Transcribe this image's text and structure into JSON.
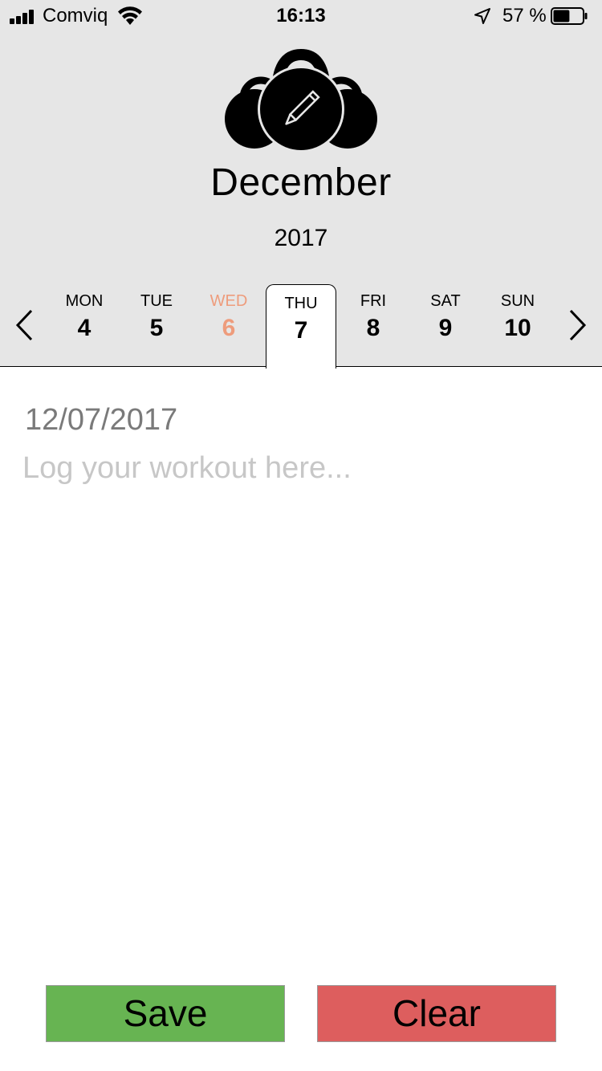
{
  "status_bar": {
    "carrier": "Comviq",
    "time": "16:13",
    "battery_percent": "57 %",
    "battery_level": 0.57
  },
  "header": {
    "logo_icon": "kettlebell-pencil-icon",
    "month": "December",
    "year": "2017"
  },
  "week": {
    "days": [
      {
        "name": "MON",
        "number": "4"
      },
      {
        "name": "TUE",
        "number": "5"
      },
      {
        "name": "WED",
        "number": "6"
      },
      {
        "name": "THU",
        "number": "7"
      },
      {
        "name": "FRI",
        "number": "8"
      },
      {
        "name": "SAT",
        "number": "9"
      },
      {
        "name": "SUN",
        "number": "10"
      }
    ],
    "today": "WED",
    "selected": "THU"
  },
  "entry": {
    "date": "12/07/2017",
    "value": "",
    "placeholder": "Log your workout here..."
  },
  "actions": {
    "save_label": "Save",
    "clear_label": "Clear"
  },
  "colors": {
    "header_bg": "#e6e6e6",
    "today_accent": "#ee9c7c",
    "save_bg": "#67b452",
    "clear_bg": "#dd5e5e"
  }
}
